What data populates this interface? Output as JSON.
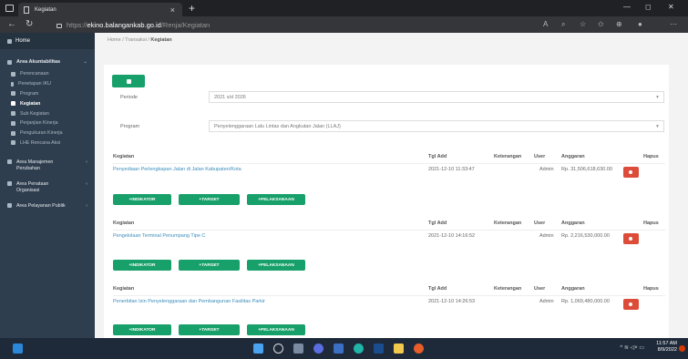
{
  "browser": {
    "tab_title": "Kegiatan",
    "url_proto": "https://",
    "url_host": "ekino.balangankab.go.id",
    "url_path": "/Renja/Kegiatan",
    "new_tab": "+",
    "close": "×"
  },
  "breadcrumb": {
    "home": "Home",
    "sep": " / ",
    "transaksi": "Transaksi",
    "current": "Kegiatan"
  },
  "sidebar": {
    "home": "Home",
    "akuntabilitas": "Area Akuntabilitas",
    "subs": [
      {
        "label": "Perencanaan"
      },
      {
        "label": "Penetapan IKU"
      },
      {
        "label": "Program"
      },
      {
        "label": "Kegiatan"
      },
      {
        "label": "Sub Kegiatan"
      },
      {
        "label": "Perjanjian Kinerja"
      },
      {
        "label": "Pengukuran Kinerja"
      },
      {
        "label": "LHE Rencana Aksi"
      }
    ],
    "manajemen": "Area Manajemen Perubahan",
    "penataan": "Area Penataan Organisasi",
    "pelayanan": "Area Pelayanan Publik"
  },
  "form": {
    "periode_label": "Periode",
    "periode_value": "2021 s/d 2026",
    "program_label": "Program",
    "program_value": "Penyelenggaraan Lalu Lintas dan Angkutan Jalan (LLAJ)"
  },
  "table": {
    "headers": {
      "kegiatan": "Kegiatan",
      "tgl": "Tgl Add",
      "ket": "Keterangan",
      "user": "User",
      "anggaran": "Anggaran",
      "hapus": "Hapus"
    },
    "rows": [
      {
        "kegiatan": "Penyediaan Perlengkapan Jalan di Jalan Kabupaten/Kota",
        "tgl": "2021-12-10 11:33:47",
        "user": "Admin",
        "anggaran": "Rp. 31,506,618,630.00"
      },
      {
        "kegiatan": "Pengelolaan Terminal Penumpang Tipe C",
        "tgl": "2021-12-10 14:16:52",
        "user": "Admin",
        "anggaran": "Rp. 2,216,530,000.00"
      },
      {
        "kegiatan": "Penerbitan Izin Penyelenggaraan dan Pembangunan Fasilitas Parkir",
        "tgl": "2021-12-10 14:26:53",
        "user": "Admin",
        "anggaran": "Rp. 1,069,480,000.00"
      }
    ],
    "btn_indikator": "+INDIKATOR",
    "btn_target": "+TARGET",
    "btn_pelaksanaan": "+PELAKSANAAN"
  },
  "taskbar": {
    "time": "11:57 AM",
    "date": "8/9/2022"
  }
}
